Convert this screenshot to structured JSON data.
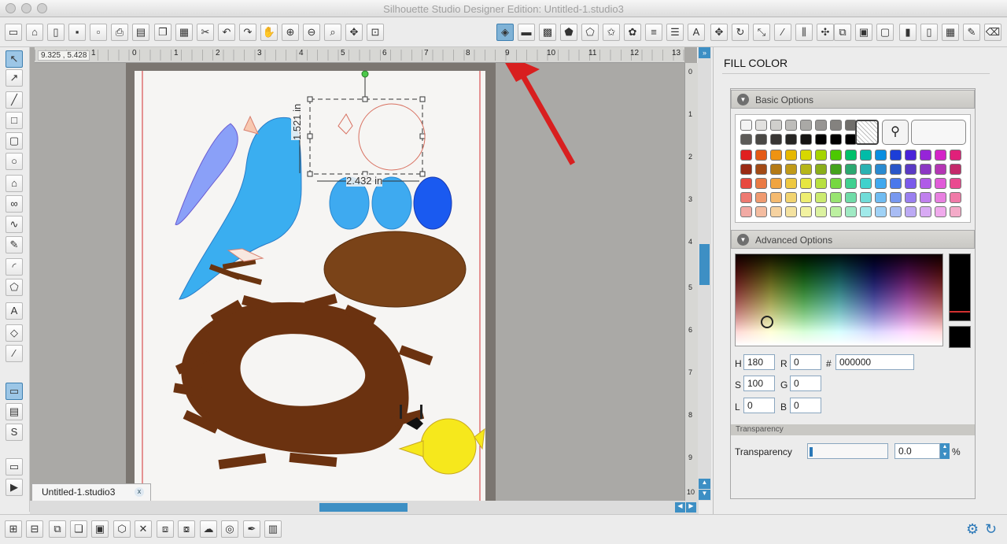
{
  "window": {
    "title": "Silhouette Studio Designer Edition: Untitled-1.studio3"
  },
  "toolbar": {
    "items": [
      "new-doc",
      "open",
      "template",
      "save",
      "save-sd",
      "print",
      "print-cut",
      "copy",
      "paste",
      "cut",
      "undo",
      "redo",
      "pan",
      "zoom-in",
      "zoom-out",
      "zoom-select",
      "zoom-drag",
      "zoom-fit",
      "fill-color",
      "line-color",
      "fill-pattern",
      "shapes",
      "polygon",
      "star",
      "replicate",
      "gradient",
      "line-style",
      "text",
      "transform",
      "rotate",
      "scale",
      "knife",
      "align",
      "weld",
      "offset",
      "library",
      "design-store",
      "cut-settings",
      "send-to",
      "page-setup",
      "grid",
      "sketch",
      "erase",
      "settings"
    ]
  },
  "ruler": {
    "coords": "9.325 , 5.428",
    "ticks": [
      "1",
      "0",
      "1",
      "2",
      "3",
      "4",
      "5",
      "6",
      "7",
      "8",
      "9",
      "10",
      "11",
      "12",
      "13"
    ]
  },
  "vruler": {
    "ticks": [
      "0",
      "1",
      "2",
      "3",
      "4",
      "5",
      "6",
      "7",
      "8",
      "9",
      "10"
    ]
  },
  "selection": {
    "height_label": "1.521 in",
    "width_label": "2.432 in"
  },
  "tab": {
    "label": "Untitled-1.studio3",
    "close": "x"
  },
  "panel": {
    "title": "FILL COLOR",
    "basic_label": "Basic Options",
    "advanced_label": "Advanced Options",
    "fields": {
      "h_label": "H",
      "h": "180",
      "s_label": "S",
      "s": "100",
      "l_label": "L",
      "l": "0",
      "r_label": "R",
      "r": "0",
      "g_label": "G",
      "g": "0",
      "b_label": "B",
      "b": "0",
      "hex_label": "#",
      "hex": "000000"
    },
    "transparency_section": "Transparency",
    "transparency_label": "Transparency",
    "transparency_value": "0.0",
    "percent": "%"
  },
  "swatch_rows": [
    [
      "#f3f3f3",
      "#e2e1df",
      "#d0cfcc",
      "#bebdba",
      "#aaa9a6",
      "#979593",
      "#84827f",
      "#706e6b"
    ],
    [
      "#5d5b58",
      "#4a4845",
      "#383634",
      "#262523",
      "#141312",
      "#000000",
      "#000000",
      "#000000"
    ],
    [
      "#e02020",
      "#e45a16",
      "#ee9312",
      "#e6b800",
      "#d8d800",
      "#a5d400",
      "#4cc800",
      "#00c06a",
      "#00bca8",
      "#0a8ee0",
      "#1c3ed8",
      "#4a23d8",
      "#9624d8",
      "#d424c8",
      "#e0207a"
    ],
    [
      "#9a2a14",
      "#a24a16",
      "#b47a16",
      "#c09a18",
      "#b6b61a",
      "#8aae1a",
      "#44a21c",
      "#2ba870",
      "#2ab2b2",
      "#2a8ad0",
      "#2a56c8",
      "#5a3ac4",
      "#8c38c4",
      "#b436b4",
      "#c42a6a"
    ],
    [
      "#e84a40",
      "#ea7a44",
      "#f0a440",
      "#eec840",
      "#e6e640",
      "#b8e040",
      "#76d840",
      "#40d090",
      "#40d2cc",
      "#40a8ee",
      "#4a78ec",
      "#7a5aea",
      "#b05ae8",
      "#e05ad8",
      "#ea4a90"
    ],
    [
      "#ee7a72",
      "#f09a70",
      "#f4ba70",
      "#f2d470",
      "#eeee70",
      "#cceb70",
      "#98e470",
      "#70dca8",
      "#70dcd8",
      "#70bcf2",
      "#7898f0",
      "#9a80f0",
      "#c080ee",
      "#e880e0",
      "#f07aa8"
    ],
    [
      "#f2aaa4",
      "#f4bca0",
      "#f6d2a0",
      "#f4e2a0",
      "#f2f2a0",
      "#dcf2a0",
      "#bcf0a0",
      "#a0eac4",
      "#a0eaea",
      "#a0d2f6",
      "#a8bcf4",
      "#bcaaf4",
      "#d8aaf4",
      "#f0aaec",
      "#f4aac8"
    ]
  ],
  "colors": {
    "accent": "#3d8fc4",
    "selected_tool": "#7fb2d6",
    "arrow": "#d81f1f"
  }
}
